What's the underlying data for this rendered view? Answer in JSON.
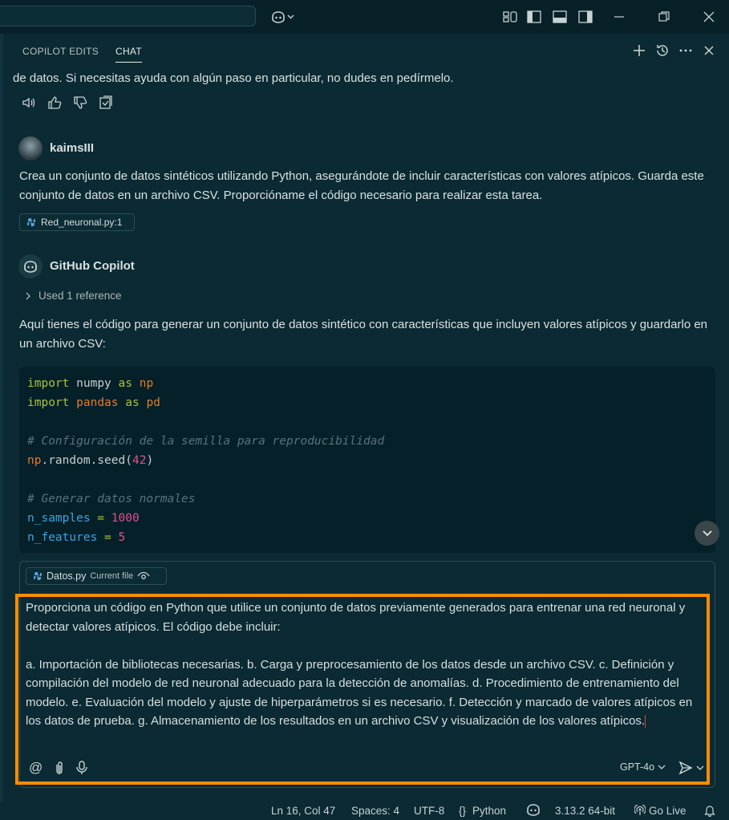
{
  "title_bar": {
    "copilot_icon": "copilot-icon",
    "icons": [
      "layout-icon",
      "toggle-sidebar-icon",
      "toggle-panel-icon",
      "toggle-secondary-sidebar-icon",
      "minimize-icon",
      "restore-icon",
      "close-icon"
    ]
  },
  "panel": {
    "tabs": [
      {
        "label": "COPILOT EDITS",
        "active": false
      },
      {
        "label": "CHAT",
        "active": true
      }
    ],
    "header_icons": [
      "new-chat-icon",
      "history-icon",
      "more-icon",
      "close-panel-icon"
    ]
  },
  "prev_response_tail": "de datos. Si necesitas ayuda con algún paso en particular, no dudes en pedírmelo.",
  "response_actions": [
    "read-aloud-icon",
    "thumbs-up-icon",
    "thumbs-down-icon",
    "insert-into-editor-icon"
  ],
  "user_message": {
    "author": "kaimsIII",
    "text": "Crea un conjunto de datos sintéticos utilizando Python, asegurándote de incluir características con valores atípicos. Guarda este conjunto de datos en un archivo CSV. Proporcióname el código necesario para realizar esta tarea.",
    "reference_chip": "Red_neuronal.py:1"
  },
  "assistant_message": {
    "author": "GitHub Copilot",
    "used_references": "Used 1 reference",
    "intro": "Aquí tienes el código para generar un conjunto de datos sintético con características que incluyen valores atípicos y guardarlo en un archivo CSV:",
    "code": {
      "l1_kw": "import",
      "l1_mod": "numpy",
      "l1_as": "as",
      "l1_alias": "np",
      "l2_kw": "import",
      "l2_mod": "pandas",
      "l2_as": "as",
      "l2_alias": "pd",
      "comment1": "# Configuración de la semilla para reproducibilidad",
      "seed_obj": "np",
      "seed_call": ".random.seed(",
      "seed_num": "42",
      "seed_close": ")",
      "comment2": "# Generar datos normales",
      "n_samples_var": "n_samples",
      "n_samples_num": "1000",
      "n_features_var": "n_features",
      "n_features_num": "5",
      "eq": " = "
    }
  },
  "input": {
    "file_chip": "Datos.py",
    "file_chip_note": "Current file",
    "text": "Proporciona un código en Python que utilice un conjunto de datos previamente generados para entrenar una red neuronal y detectar valores atípicos. El código debe incluir:\n\na. Importación de bibliotecas necesarias. b. Carga y preprocesamiento de los datos desde un archivo CSV. c. Definición y compilación del modelo de red neuronal adecuado para la detección de anomalías. d. Procedimiento de entrenamiento del modelo. e. Evaluación del modelo y ajuste de hiperparámetros si es necesario. f. Detección y marcado de valores atípicos en los datos de prueba. g. Almacenamiento de los resultados en un archivo CSV y visualización de los valores atípicos.",
    "model": "GPT-4o"
  },
  "status_bar": {
    "position": "Ln 16, Col 47",
    "spaces": "Spaces: 4",
    "encoding": "UTF-8",
    "language": "Python",
    "python_version": "3.13.2 64-bit",
    "go_live": "Go Live"
  },
  "colors": {
    "background": "#0b2a33",
    "highlight_border": "#ff8c00",
    "keyword": "#a9c23f",
    "module": "#e07b2a",
    "number": "#e0508e",
    "variable": "#3aa4e0"
  }
}
